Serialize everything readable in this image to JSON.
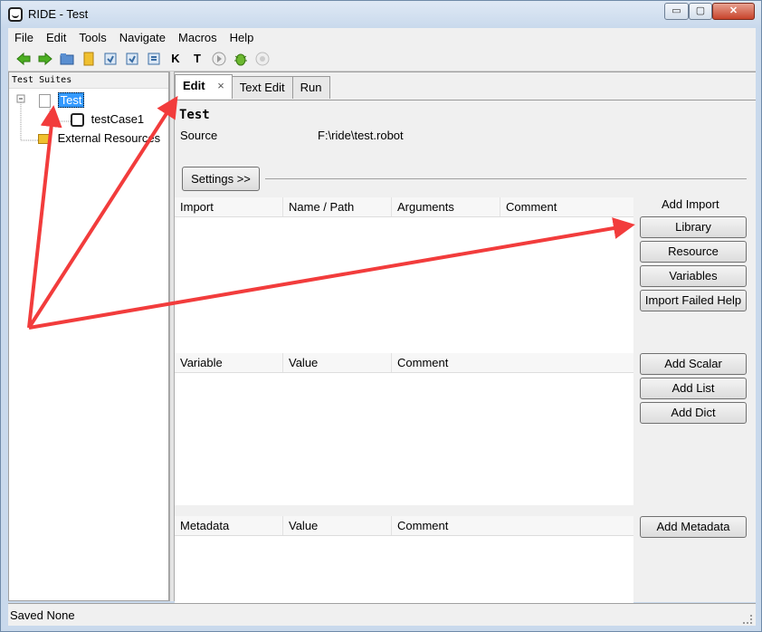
{
  "window": {
    "title": "RIDE - Test",
    "controls": {
      "minimize": "▭",
      "maximize": "▢",
      "close": "✕"
    }
  },
  "menubar": [
    "File",
    "Edit",
    "Tools",
    "Navigate",
    "Macros",
    "Help"
  ],
  "toolbar": {
    "icons": [
      "back-arrow-icon",
      "forward-arrow-icon",
      "open-folder-icon",
      "open-directory-icon",
      "save-icon",
      "save-all-icon",
      "search-keywords-icon",
      "keyword-icon",
      "tag-icon",
      "run-icon",
      "debug-bug-icon",
      "stop-icon"
    ],
    "k_label": "K",
    "t_label": "T"
  },
  "left_pane": {
    "header": "Test Suites",
    "tree": {
      "root": "Test",
      "child": "testCase1",
      "external": "External Resources"
    }
  },
  "tabs": {
    "edit": "Edit",
    "edit_close": "×",
    "text_edit": "Text Edit",
    "run": "Run"
  },
  "suite": {
    "title": "Test",
    "source_label": "Source",
    "source_value": "F:\\ride\\test.robot",
    "settings_button": "Settings >>"
  },
  "imports": {
    "headers": [
      "Import",
      "Name / Path",
      "Arguments",
      "Comment"
    ],
    "add_label": "Add Import",
    "buttons": [
      "Library",
      "Resource",
      "Variables",
      "Import Failed Help"
    ]
  },
  "variables": {
    "headers": [
      "Variable",
      "Value",
      "Comment"
    ],
    "buttons": [
      "Add Scalar",
      "Add List",
      "Add Dict"
    ]
  },
  "metadata": {
    "headers": [
      "Metadata",
      "Value",
      "Comment"
    ],
    "button": "Add Metadata"
  },
  "status": "Saved None",
  "colors": {
    "annotation_arrow": "#f23c3c",
    "selection": "#3399ff"
  }
}
